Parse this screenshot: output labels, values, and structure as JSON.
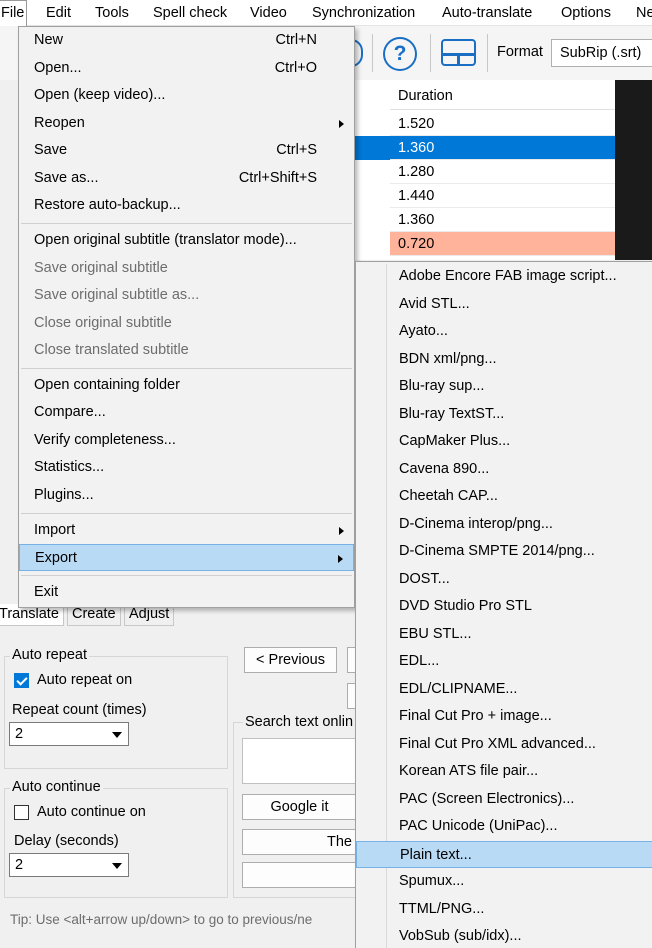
{
  "menubar": {
    "items": [
      {
        "label": "File"
      },
      {
        "label": "Edit"
      },
      {
        "label": "Tools"
      },
      {
        "label": "Spell check"
      },
      {
        "label": "Video"
      },
      {
        "label": "Synchronization"
      },
      {
        "label": "Auto-translate"
      },
      {
        "label": "Options"
      },
      {
        "label": "Ne"
      }
    ]
  },
  "toolbar": {
    "help_icon": "?",
    "format_label": "Format",
    "format_value": "SubRip (.srt)"
  },
  "grid": {
    "column": "Duration",
    "rows": [
      "1.520",
      "1.360",
      "1.280",
      "1.440",
      "1.360",
      "0.720"
    ]
  },
  "file_menu": {
    "items": [
      {
        "label": "New",
        "shortcut": "Ctrl+N"
      },
      {
        "label": "Open...",
        "shortcut": "Ctrl+O"
      },
      {
        "label": "Open (keep video)...",
        "shortcut": ""
      },
      {
        "label": "Reopen",
        "shortcut": ""
      },
      {
        "label": "Save",
        "shortcut": "Ctrl+S"
      },
      {
        "label": "Save as...",
        "shortcut": "Ctrl+Shift+S"
      },
      {
        "label": "Restore auto-backup...",
        "shortcut": ""
      },
      {
        "label": "Open original subtitle (translator mode)...",
        "shortcut": ""
      },
      {
        "label": "Save original subtitle",
        "shortcut": ""
      },
      {
        "label": "Save original subtitle as...",
        "shortcut": ""
      },
      {
        "label": "Close original subtitle",
        "shortcut": ""
      },
      {
        "label": "Close translated subtitle",
        "shortcut": ""
      },
      {
        "label": "Open containing folder",
        "shortcut": ""
      },
      {
        "label": "Compare...",
        "shortcut": ""
      },
      {
        "label": "Verify completeness...",
        "shortcut": ""
      },
      {
        "label": "Statistics...",
        "shortcut": ""
      },
      {
        "label": "Plugins...",
        "shortcut": ""
      },
      {
        "label": "Import",
        "shortcut": ""
      },
      {
        "label": "Export",
        "shortcut": ""
      },
      {
        "label": "Exit",
        "shortcut": ""
      }
    ]
  },
  "export_menu": {
    "items": [
      "Adobe Encore FAB image script...",
      "Avid STL...",
      "Ayato...",
      "BDN xml/png...",
      "Blu-ray sup...",
      "Blu-ray TextST...",
      "CapMaker Plus...",
      "Cavena 890...",
      "Cheetah CAP...",
      "D-Cinema interop/png...",
      "D-Cinema SMPTE 2014/png...",
      "DOST...",
      "DVD Studio Pro STL",
      "EBU STL...",
      "EDL...",
      "EDL/CLIPNAME...",
      "Final Cut Pro + image...",
      "Final Cut Pro XML advanced...",
      "Korean ATS file pair...",
      "PAC (Screen Electronics)...",
      "PAC Unicode (UniPac)...",
      "Plain text...",
      "Spumux...",
      "TTML/PNG...",
      "VobSub (sub/idx)..."
    ]
  },
  "tabs": [
    {
      "label": "Translate"
    },
    {
      "label": "Create"
    },
    {
      "label": "Adjust"
    }
  ],
  "panel": {
    "auto_repeat_title": "Auto repeat",
    "auto_repeat_on": "Auto repeat on",
    "repeat_count_label": "Repeat count (times)",
    "repeat_count_value": "2",
    "auto_continue_title": "Auto continue",
    "auto_continue_on": "Auto continue on",
    "delay_label": "Delay (seconds)",
    "delay_value": "2",
    "previous_button": "< Previous",
    "search_label": "Search text onlin",
    "google_button": "Google it",
    "the_button": "The",
    "tip": "Tip: Use <alt+arrow up/down> to go to previous/ne"
  }
}
